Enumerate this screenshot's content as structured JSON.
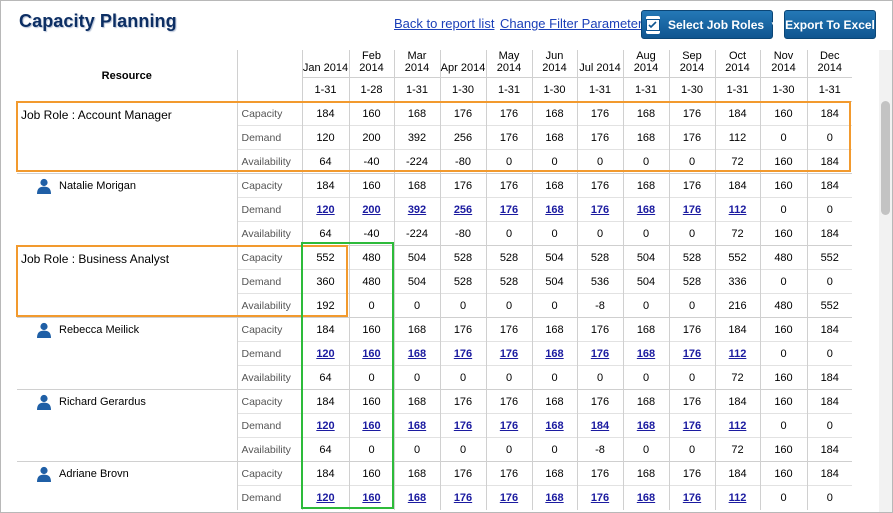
{
  "header": {
    "title": "Capacity Planning",
    "back_link": "Back to report list",
    "filter_link": "Change Filter Parameter",
    "select_roles_label": "Select Job Roles",
    "export_label": "Export To Excel"
  },
  "grid": {
    "resource_header": "Resource",
    "months": [
      {
        "name": "Jan 2014",
        "range": "1-31"
      },
      {
        "name": "Feb 2014",
        "range": "1-28"
      },
      {
        "name": "Mar 2014",
        "range": "1-31"
      },
      {
        "name": "Apr 2014",
        "range": "1-30"
      },
      {
        "name": "May 2014",
        "range": "1-31"
      },
      {
        "name": "Jun 2014",
        "range": "1-30"
      },
      {
        "name": "Jul 2014",
        "range": "1-31"
      },
      {
        "name": "Aug 2014",
        "range": "1-31"
      },
      {
        "name": "Sep 2014",
        "range": "1-30"
      },
      {
        "name": "Oct 2014",
        "range": "1-31"
      },
      {
        "name": "Nov 2014",
        "range": "1-30"
      },
      {
        "name": "Dec 2014",
        "range": "1-31"
      }
    ],
    "metric_labels": {
      "capacity": "Capacity",
      "demand": "Demand",
      "availability": "Availability"
    },
    "groups": [
      {
        "kind": "role",
        "label": "Job Role : Account Manager",
        "capacity": [
          "184",
          "160",
          "168",
          "176",
          "176",
          "168",
          "176",
          "168",
          "176",
          "184",
          "160",
          "184"
        ],
        "demand": [
          "120",
          "200",
          "392",
          "256",
          "176",
          "168",
          "176",
          "168",
          "176",
          "112",
          "0",
          "0"
        ],
        "availability": [
          "64",
          "-40",
          "-224",
          "-80",
          "0",
          "0",
          "0",
          "0",
          "0",
          "72",
          "160",
          "184"
        ],
        "demand_links": [
          false,
          false,
          false,
          false,
          false,
          false,
          false,
          false,
          false,
          false,
          false,
          false
        ]
      },
      {
        "kind": "person",
        "label": "Natalie Morigan",
        "capacity": [
          "184",
          "160",
          "168",
          "176",
          "176",
          "168",
          "176",
          "168",
          "176",
          "184",
          "160",
          "184"
        ],
        "demand": [
          "120",
          "200",
          "392",
          "256",
          "176",
          "168",
          "176",
          "168",
          "176",
          "112",
          "0",
          "0"
        ],
        "availability": [
          "64",
          "-40",
          "-224",
          "-80",
          "0",
          "0",
          "0",
          "0",
          "0",
          "72",
          "160",
          "184"
        ],
        "demand_links": [
          true,
          true,
          true,
          true,
          true,
          true,
          true,
          true,
          true,
          true,
          false,
          false
        ]
      },
      {
        "kind": "role",
        "label": "Job Role : Business Analyst",
        "capacity": [
          "552",
          "480",
          "504",
          "528",
          "528",
          "504",
          "528",
          "504",
          "528",
          "552",
          "480",
          "552"
        ],
        "demand": [
          "360",
          "480",
          "504",
          "528",
          "528",
          "504",
          "536",
          "504",
          "528",
          "336",
          "0",
          "0"
        ],
        "availability": [
          "192",
          "0",
          "0",
          "0",
          "0",
          "0",
          "-8",
          "0",
          "0",
          "216",
          "480",
          "552"
        ],
        "demand_links": [
          false,
          false,
          false,
          false,
          false,
          false,
          false,
          false,
          false,
          false,
          false,
          false
        ]
      },
      {
        "kind": "person",
        "label": "Rebecca Meilick",
        "capacity": [
          "184",
          "160",
          "168",
          "176",
          "176",
          "168",
          "176",
          "168",
          "176",
          "184",
          "160",
          "184"
        ],
        "demand": [
          "120",
          "160",
          "168",
          "176",
          "176",
          "168",
          "176",
          "168",
          "176",
          "112",
          "0",
          "0"
        ],
        "availability": [
          "64",
          "0",
          "0",
          "0",
          "0",
          "0",
          "0",
          "0",
          "0",
          "72",
          "160",
          "184"
        ],
        "demand_links": [
          true,
          true,
          true,
          true,
          true,
          true,
          true,
          true,
          true,
          true,
          false,
          false
        ]
      },
      {
        "kind": "person",
        "label": "Richard Gerardus",
        "capacity": [
          "184",
          "160",
          "168",
          "176",
          "176",
          "168",
          "176",
          "168",
          "176",
          "184",
          "160",
          "184"
        ],
        "demand": [
          "120",
          "160",
          "168",
          "176",
          "176",
          "168",
          "184",
          "168",
          "176",
          "112",
          "0",
          "0"
        ],
        "availability": [
          "64",
          "0",
          "0",
          "0",
          "0",
          "0",
          "-8",
          "0",
          "0",
          "72",
          "160",
          "184"
        ],
        "demand_links": [
          true,
          true,
          true,
          true,
          true,
          true,
          true,
          true,
          true,
          true,
          false,
          false
        ]
      },
      {
        "kind": "person",
        "label": "Adriane Brovn",
        "capacity": [
          "184",
          "160",
          "168",
          "176",
          "176",
          "168",
          "176",
          "168",
          "176",
          "184",
          "160",
          "184"
        ],
        "demand": [
          "120",
          "160",
          "168",
          "176",
          "176",
          "168",
          "176",
          "168",
          "176",
          "112",
          "0",
          "0"
        ],
        "availability": [],
        "demand_links": [
          true,
          true,
          true,
          true,
          true,
          true,
          true,
          true,
          true,
          true,
          false,
          false
        ]
      }
    ]
  },
  "colors": {
    "role_highlight": "#f29a2e",
    "column_highlight": "#2dbb3a",
    "link": "#1b1ba0",
    "title": "#0c2e63"
  },
  "icons": {
    "person": "user-icon",
    "roles_button": "select-icon"
  }
}
